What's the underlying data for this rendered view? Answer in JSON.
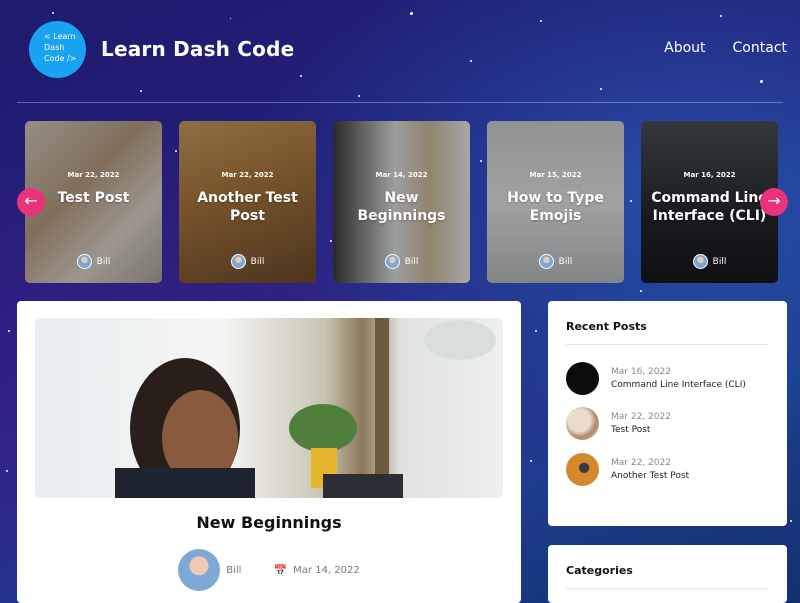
{
  "site": {
    "logo_text": "< Learn Dash Code />",
    "title": "Learn Dash Code"
  },
  "nav": {
    "about": "About",
    "contact": "Contact"
  },
  "carousel": {
    "prev_icon": "arrow-left-icon",
    "next_icon": "arrow-right-icon",
    "cards": [
      {
        "date": "Mar 22, 2022",
        "title": "Test Post",
        "author": "Bill"
      },
      {
        "date": "Mar 22, 2022",
        "title": "Another Test Post",
        "author": "Bill"
      },
      {
        "date": "Mar 14, 2022",
        "title": "New Beginnings",
        "author": "Bill"
      },
      {
        "date": "Mar 15, 2022",
        "title": "How to Type Emojis",
        "author": "Bill"
      },
      {
        "date": "Mar 16, 2022",
        "title": "Command Line Interface (CLI)",
        "author": "Bill"
      }
    ]
  },
  "post": {
    "title": "New Beginnings",
    "author": "Bill",
    "date": "Mar 14, 2022"
  },
  "sidebar": {
    "recent_heading": "Recent Posts",
    "recent": [
      {
        "date": "Mar 16, 2022",
        "title": "Command Line Interface (CLI)"
      },
      {
        "date": "Mar 22, 2022",
        "title": "Test Post"
      },
      {
        "date": "Mar 22, 2022",
        "title": "Another Test Post"
      }
    ],
    "categories_heading": "Categories"
  },
  "colors": {
    "accent": "#e8337a",
    "logo": "#1aa3f0"
  }
}
